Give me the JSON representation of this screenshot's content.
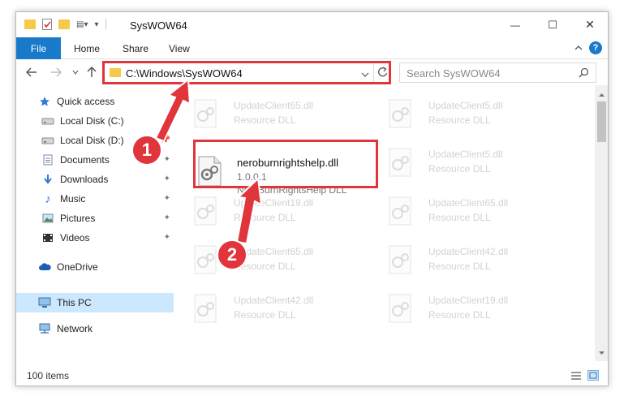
{
  "window": {
    "title": "SysWOW64",
    "minimize_glyph": "—",
    "maximize_glyph": "☐",
    "close_glyph": "✕"
  },
  "ribbon": {
    "file_tab": "File",
    "tabs": [
      "Home",
      "Share",
      "View"
    ],
    "help_glyph": "?"
  },
  "address": {
    "path": "C:\\Windows\\SysWOW64",
    "search_placeholder": "Search SysWOW64"
  },
  "nav": {
    "items": [
      {
        "label": "Quick access",
        "icon": "star-icon",
        "pinned": false
      },
      {
        "label": "Local Disk (C:)",
        "icon": "drive-icon",
        "pinned": false
      },
      {
        "label": "Local Disk (D:)",
        "icon": "drive-icon",
        "pinned": false
      },
      {
        "label": "Documents",
        "icon": "documents-icon",
        "pinned": true
      },
      {
        "label": "Downloads",
        "icon": "download-icon",
        "pinned": true
      },
      {
        "label": "Music",
        "icon": "music-icon",
        "pinned": true
      },
      {
        "label": "Pictures",
        "icon": "pictures-icon",
        "pinned": true
      },
      {
        "label": "Videos",
        "icon": "videos-icon",
        "pinned": true
      },
      {
        "label": "OneDrive",
        "icon": "cloud-icon",
        "pinned": false
      },
      {
        "label": "This PC",
        "icon": "computer-icon",
        "pinned": false,
        "selected": true
      },
      {
        "label": "Network",
        "icon": "network-icon",
        "pinned": false
      }
    ]
  },
  "files": {
    "highlighted": {
      "name": "neroburnrightshelp.dll",
      "version": "1.0.0.1",
      "description": "NeroBurnRightsHelp DLL"
    },
    "ghosts": [
      {
        "name": "UpdateClient65.dll",
        "sub": "Resource DLL"
      },
      {
        "name": "UpdateClient5.dll",
        "sub": "Resource DLL"
      },
      {
        "name": "UpdateClient5.dll",
        "sub": "Resource DLL"
      },
      {
        "name": "UpdateClient19.dll",
        "sub": "Resource DLL"
      },
      {
        "name": "UpdateClient65.dll",
        "sub": "Resource DLL"
      },
      {
        "name": "UpdateClient65.dll",
        "sub": "Resource DLL"
      },
      {
        "name": "UpdateClient42.dll",
        "sub": "Resource DLL"
      },
      {
        "name": "UpdateClient42.dll",
        "sub": "Resource DLL"
      },
      {
        "name": "UpdateClient19.dll",
        "sub": "Resource DLL"
      }
    ]
  },
  "status": {
    "items_count": "100 items"
  },
  "annotations": {
    "step1": "1",
    "step2": "2",
    "highlight_color": "#e0353b"
  },
  "colors": {
    "accent": "#1979ca",
    "selection": "#cce8ff"
  }
}
